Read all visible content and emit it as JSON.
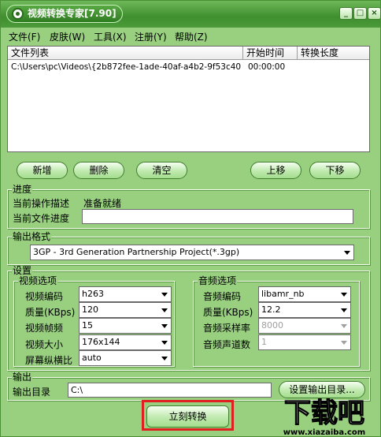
{
  "window": {
    "title": "视频转换专家[7.90]",
    "minimize": "_",
    "maximize": "□",
    "close": "×"
  },
  "menu": [
    "文件(F)",
    "皮肤(W)",
    "工具(X)",
    "注册(Y)",
    "帮助(Z)"
  ],
  "filelist": {
    "columns": [
      "文件列表",
      "开始时间",
      "转换长度"
    ],
    "rows": [
      {
        "file": "C:\\Users\\pc\\Videos\\{2b872fee-1ade-40af-a4b2-9f53c40ac...",
        "start": "00:00:00",
        "length": ""
      }
    ]
  },
  "actions": {
    "add": "新增",
    "delete": "删除",
    "clear": "清空",
    "up": "上移",
    "down": "下移"
  },
  "progress": {
    "group": "进度",
    "op_label": "当前操作描述",
    "op_value": "准备就绪",
    "file_label": "当前文件进度"
  },
  "output_format": {
    "group": "输出格式",
    "value": "3GP - 3rd Generation Partnership Project(*.3gp)"
  },
  "settings": {
    "group": "设置",
    "video": {
      "group": "视频选项",
      "codec_label": "视频编码",
      "codec": "h263",
      "quality_label": "质量(KBps)",
      "quality": "120",
      "fps_label": "视频帧频",
      "fps": "15",
      "size_label": "视频大小",
      "size": "176x144",
      "aspect_label": "屏幕纵横比",
      "aspect": "auto"
    },
    "audio": {
      "group": "音频选项",
      "codec_label": "音频编码",
      "codec": "libamr_nb",
      "quality_label": "质量(KBps)",
      "quality": "12.2",
      "rate_label": "音频采样率",
      "rate": "8000",
      "channels_label": "音频声道数",
      "channels": "1"
    }
  },
  "output": {
    "group": "输出",
    "dir_label": "输出目录",
    "dir": "C:\\",
    "set_button": "设置输出目录..."
  },
  "convert_button": "立刻转换",
  "watermark": {
    "logo": "下载吧",
    "url": "www.xiazaiba.com"
  }
}
